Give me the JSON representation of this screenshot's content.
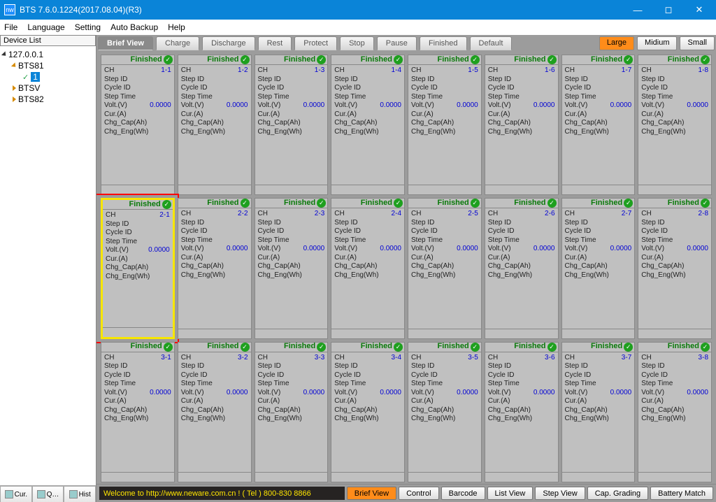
{
  "titlebar": {
    "app_icon_text": "nw",
    "title": "BTS 7.6.0.1224(2017.08.04)(R3)"
  },
  "menu": [
    "File",
    "Language",
    "Setting",
    "Auto Backup",
    "Help"
  ],
  "sidebar": {
    "header": "Device List",
    "tree": [
      {
        "label": "127.0.0.1",
        "indent": 0,
        "tri": "open",
        "triColor": "black"
      },
      {
        "label": "BTS81",
        "indent": 1,
        "tri": "open",
        "triColor": "orange"
      },
      {
        "label": "1",
        "indent": 2,
        "check": true,
        "selected": true
      },
      {
        "label": "BTSV",
        "indent": 1,
        "tri": "closed",
        "triColor": "orange"
      },
      {
        "label": "BTS82",
        "indent": 1,
        "tri": "closed",
        "triColor": "orange"
      }
    ],
    "bottom_tabs": [
      {
        "label": "Cur."
      },
      {
        "label": "Q…"
      },
      {
        "label": "Hist"
      }
    ]
  },
  "toptabs": {
    "active": "Brief View",
    "items": [
      "Brief View",
      "Charge",
      "Discharge",
      "Rest",
      "Protect",
      "Stop",
      "Pause",
      "Finished",
      "Default"
    ],
    "sizes": [
      "Large",
      "Midium",
      "Small"
    ],
    "size_active": "Large"
  },
  "card_labels": {
    "status": "Finished",
    "ch": "CH",
    "step_id": "Step ID",
    "cycle_id": "Cycle ID",
    "step_time": "Step Time",
    "volt": "Volt.(V)",
    "cur": "Cur.(A)",
    "chg_cap": "Chg_Cap(Ah)",
    "chg_eng": "Chg_Eng(Wh)",
    "volt_val": "0.0000"
  },
  "channels": [
    {
      "id": "1-1"
    },
    {
      "id": "1-2"
    },
    {
      "id": "1-3"
    },
    {
      "id": "1-4"
    },
    {
      "id": "1-5"
    },
    {
      "id": "1-6"
    },
    {
      "id": "1-7"
    },
    {
      "id": "1-8"
    },
    {
      "id": "2-1",
      "hl": true
    },
    {
      "id": "2-2"
    },
    {
      "id": "2-3"
    },
    {
      "id": "2-4"
    },
    {
      "id": "2-5"
    },
    {
      "id": "2-6"
    },
    {
      "id": "2-7"
    },
    {
      "id": "2-8"
    },
    {
      "id": "3-1"
    },
    {
      "id": "3-2"
    },
    {
      "id": "3-3"
    },
    {
      "id": "3-4"
    },
    {
      "id": "3-5"
    },
    {
      "id": "3-6"
    },
    {
      "id": "3-7"
    },
    {
      "id": "3-8"
    }
  ],
  "bottom": {
    "welcome": "Welcome to http://www.neware.com.cn !    ( Tel ) 800-830 8866",
    "buttons": [
      "Brief View",
      "Control",
      "Barcode",
      "List View",
      "Step View",
      "Cap. Grading",
      "Battery Match"
    ],
    "active": "Brief View"
  }
}
